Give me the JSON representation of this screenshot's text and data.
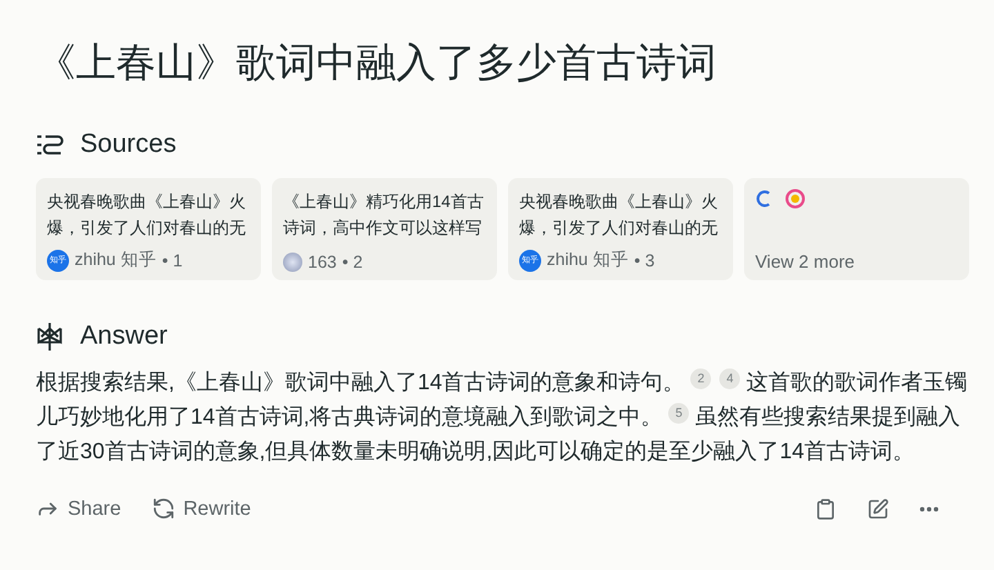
{
  "title": "《上春山》歌词中融入了多少首古诗词",
  "sources": {
    "heading": "Sources",
    "items": [
      {
        "kind": "source",
        "title_lines": [
          "央视春晚歌曲《上春山》火",
          "爆，引发了人们对春山的无"
        ],
        "site": "zhihu 知乎",
        "badge": "知乎",
        "index": "• 1"
      },
      {
        "kind": "source",
        "title_lines": [
          "《上春山》精巧化用14首古",
          "诗词，高中作文可以这样写"
        ],
        "site": "163",
        "index": "• 2"
      },
      {
        "kind": "source",
        "title_lines": [
          "央视春晚歌曲《上春山》火",
          "爆，引发了人们对春山的无"
        ],
        "site": "zhihu 知乎",
        "badge": "知乎",
        "index": "• 3"
      },
      {
        "kind": "more",
        "label": "View 2 more"
      }
    ]
  },
  "answer": {
    "heading": "Answer",
    "lines": [
      [
        {
          "kind": "text",
          "text": "根据搜索结果,《上春山》歌词中融入了14首古诗词的意象和诗句。"
        },
        {
          "kind": "citation",
          "text": "2"
        },
        {
          "kind": "citation",
          "text": "4"
        },
        {
          "kind": "text",
          "text": "这首歌的歌词作者玉镯"
        }
      ],
      [
        {
          "kind": "text",
          "text": "儿巧妙地化用了14首古诗词,将古典诗词的意境融入到歌词之中。"
        },
        {
          "kind": "citation",
          "text": "5"
        },
        {
          "kind": "text",
          "text": "虽然有些搜索结果提到融入"
        }
      ],
      [
        {
          "kind": "text",
          "text": "了近30首古诗词的意象,但具体数量未明确说明,因此可以确定的是至少融入了14首古诗词。"
        }
      ]
    ]
  },
  "actions": [
    {
      "kind": "share",
      "label": "Share"
    },
    {
      "kind": "rewrite",
      "label": "Rewrite"
    }
  ]
}
